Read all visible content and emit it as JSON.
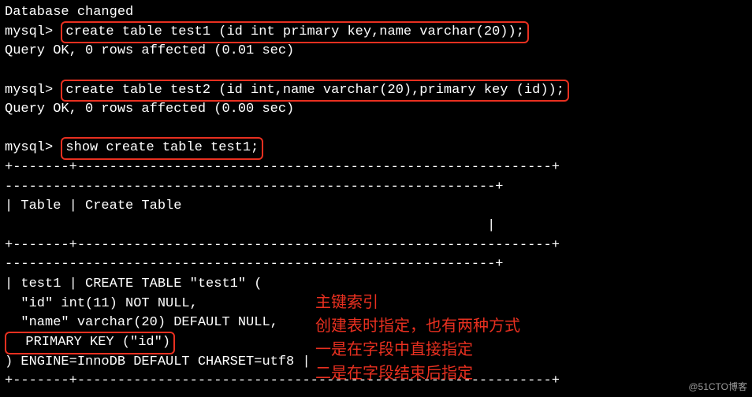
{
  "lines": {
    "db_changed": "Database changed",
    "prompt": "mysql> ",
    "cmd1": "create table test1 (id int primary key,name varchar(20));",
    "ok1": "Query OK, 0 rows affected (0.01 sec)",
    "blank": "",
    "cmd2": "create table test2 (id int,name varchar(20),primary key (id));",
    "ok2": "Query OK, 0 rows affected (0.00 sec)",
    "cmd3": "show create table test1;",
    "sep_plus": "+-------+-----------------------------------------------------------+",
    "sep_dash": "-------------------------------------------------------------+",
    "hdr": "| Table | Create Table",
    "hdr_end": "                                                            |",
    "row_start": "| test1 | CREATE TABLE \"test1\" (",
    "row_id": "  \"id\" int(11) NOT NULL,",
    "row_name": "  \"name\" varchar(20) DEFAULT NULL,",
    "row_pk": "  PRIMARY KEY (\"id\")",
    "row_engine": ") ENGINE=InnoDB DEFAULT CHARSET=utf8 |"
  },
  "annot": {
    "a1": "主键索引",
    "a2": "创建表时指定，也有两种方式",
    "a3": "一是在字段中直接指定",
    "a4": "二是在字段结束后指定"
  },
  "watermark": "@51CTO博客"
}
